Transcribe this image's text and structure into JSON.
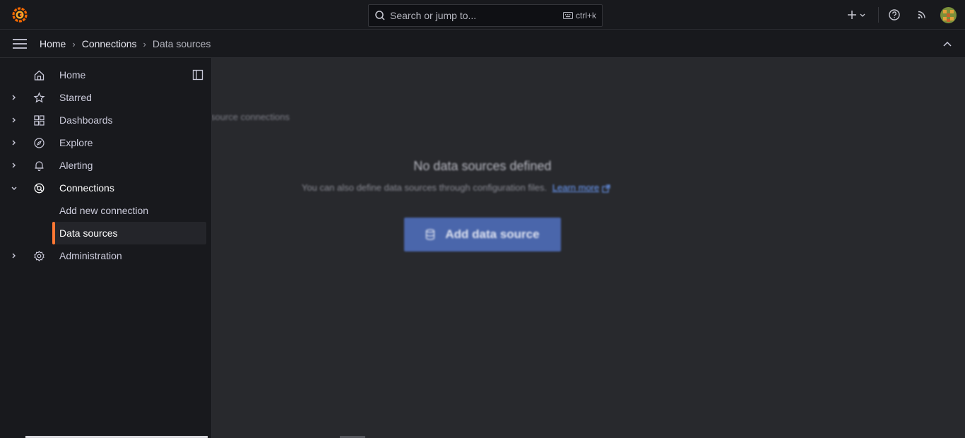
{
  "topbar": {
    "search_placeholder": "Search or jump to...",
    "search_shortcut": "ctrl+k"
  },
  "breadcrumb": {
    "items": [
      "Home",
      "Connections"
    ],
    "current": "Data sources"
  },
  "sidebar": {
    "items": [
      {
        "label": "Home",
        "icon": "home-icon"
      },
      {
        "label": "Starred",
        "icon": "star-icon"
      },
      {
        "label": "Dashboards",
        "icon": "apps-icon"
      },
      {
        "label": "Explore",
        "icon": "compass-icon"
      },
      {
        "label": "Alerting",
        "icon": "bell-icon"
      },
      {
        "label": "Connections",
        "icon": "connections-icon"
      },
      {
        "label": "Add new connection"
      },
      {
        "label": "Data sources"
      },
      {
        "label": "Administration",
        "icon": "cog-icon"
      }
    ]
  },
  "main": {
    "subtitle": "source connections",
    "empty_title": "No data sources defined",
    "empty_text": "You can also define data sources through configuration files.",
    "learn_more": "Learn more",
    "add_button": "Add data source"
  },
  "colors": {
    "accent": "#ff7733",
    "primary_button": "#4a66ab",
    "link": "#6e9fff"
  }
}
